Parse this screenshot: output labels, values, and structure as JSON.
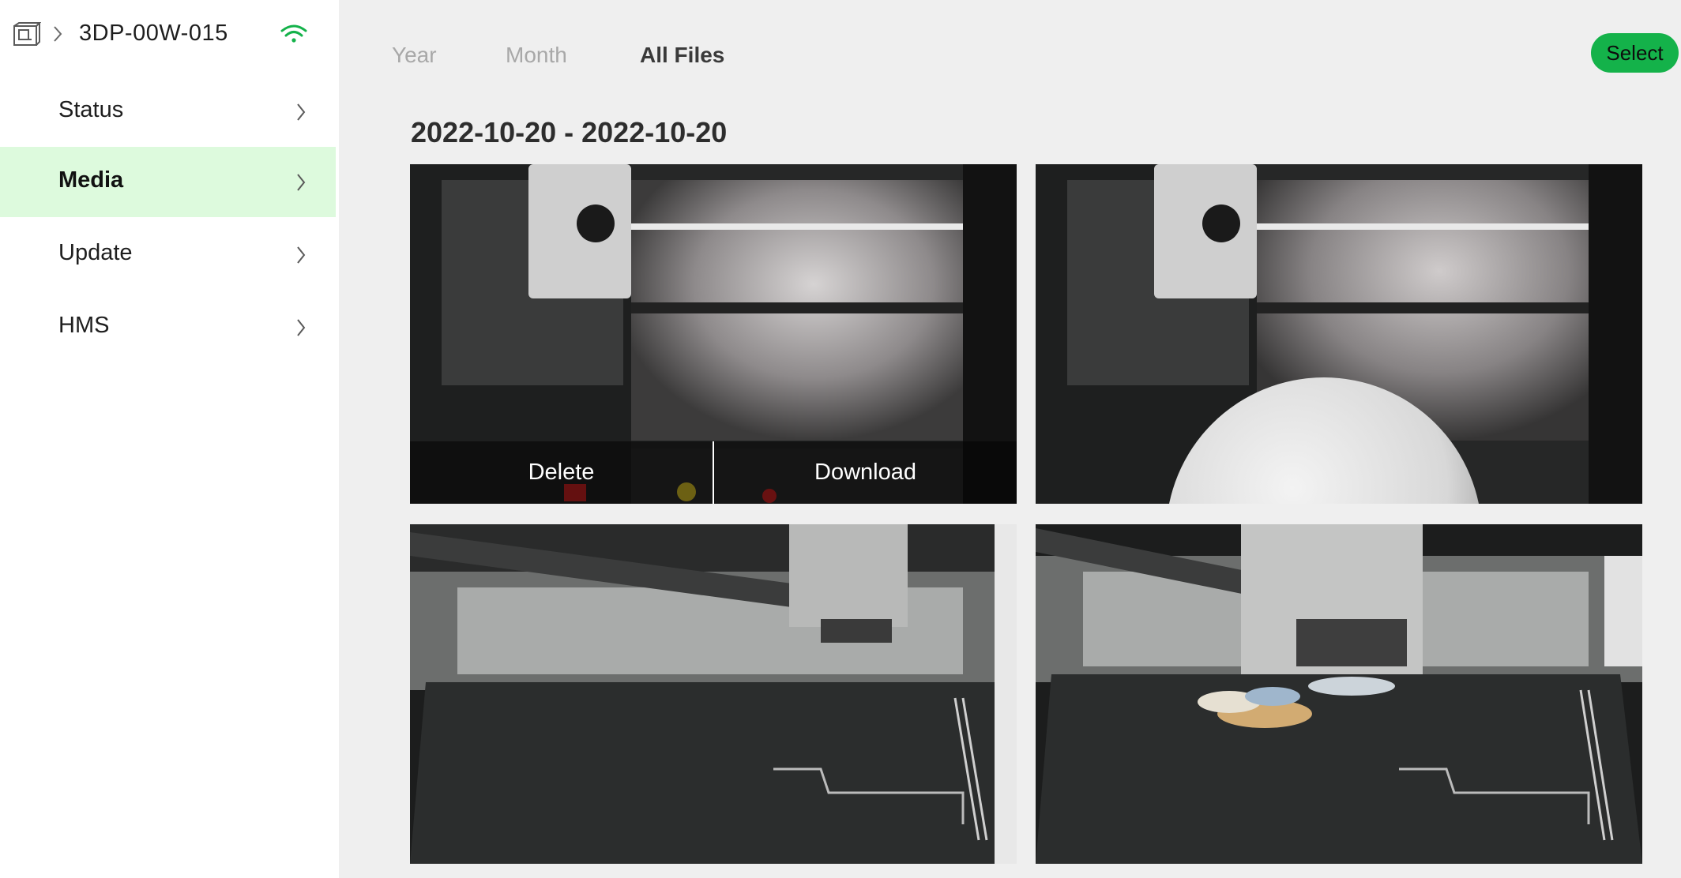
{
  "device": {
    "name": "3DP-00W-015",
    "printer_icon": "printer-box-icon",
    "connection_icon": "wifi-icon",
    "wifi_color": "#14b24a"
  },
  "sidebar": {
    "items": [
      {
        "label": "Status",
        "active": false
      },
      {
        "label": "Media",
        "active": true
      },
      {
        "label": "Update",
        "active": false
      },
      {
        "label": "HMS",
        "active": false
      }
    ],
    "active_bg": "#ddfadd"
  },
  "tabs": [
    {
      "label": "Year",
      "active": false
    },
    {
      "label": "Month",
      "active": false
    },
    {
      "label": "All Files",
      "active": true
    }
  ],
  "select_button": {
    "label": "Select",
    "color": "#14b24a"
  },
  "group": {
    "date_range": "2022-10-20 - 2022-10-20",
    "files": [
      {
        "kind": "timelapse-thumbnail",
        "subject": "printer chamber, toolhead top-left",
        "hover_actions": [
          "Delete",
          "Download"
        ]
      },
      {
        "kind": "timelapse-thumbnail",
        "subject": "printer chamber with white sphere print"
      },
      {
        "kind": "timelapse-thumbnail",
        "subject": "empty build plate, toolhead right"
      },
      {
        "kind": "timelapse-thumbnail",
        "subject": "build plate with multicolor print"
      }
    ]
  },
  "overlay": {
    "delete_label": "Delete",
    "download_label": "Download"
  }
}
